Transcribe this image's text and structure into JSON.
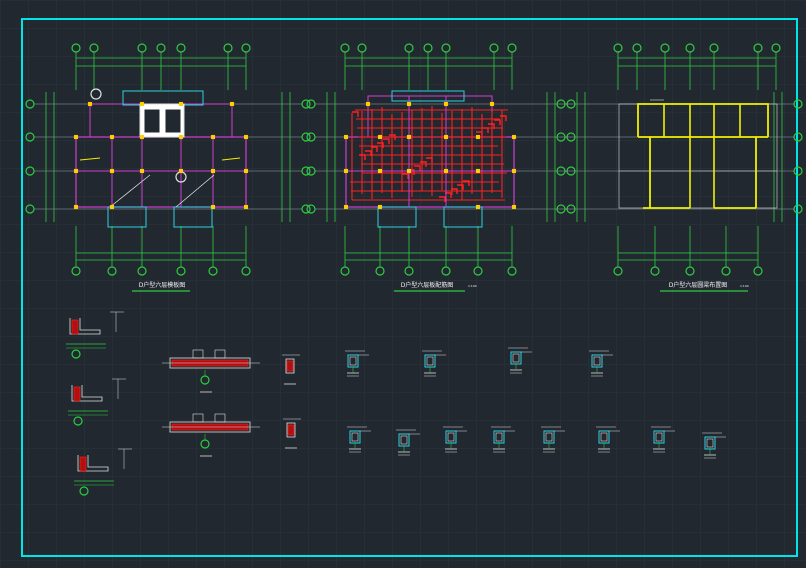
{
  "drawing": {
    "plan_titles": [
      "D户型六层模板图",
      "D户型六层板配筋图",
      "D户型六层圆梁布置图"
    ],
    "scale_note": "1:100"
  },
  "colors": {
    "background": "#212830",
    "frame": "#00e5e5",
    "axis": "#2ecc40",
    "wall": "#d040d0",
    "rebar": "#ff2020",
    "beam": "#f0f000",
    "outline": "#e0e0e0",
    "column": "#ffd000",
    "cyan": "#30d0e0"
  }
}
